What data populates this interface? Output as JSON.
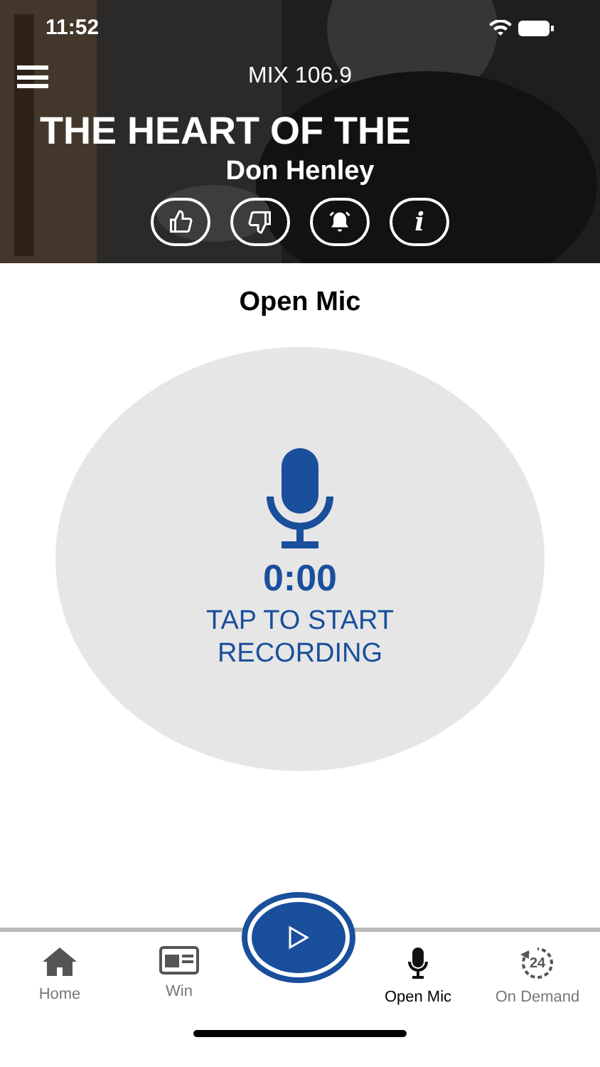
{
  "status_bar": {
    "time": "11:52"
  },
  "header": {
    "station": "MIX 106.9",
    "song_title": "THE HEART OF THE",
    "artist": "Don Henley",
    "actions": [
      {
        "kind": "like"
      },
      {
        "kind": "dislike"
      },
      {
        "kind": "alarm"
      },
      {
        "kind": "info",
        "label": "i"
      }
    ]
  },
  "page_title": "Open Mic",
  "recorder": {
    "timer": "0:00",
    "prompt": "TAP TO START RECORDING"
  },
  "tabs": [
    {
      "kind": "home",
      "label": "Home",
      "selected": false
    },
    {
      "kind": "win",
      "label": "Win",
      "selected": false
    },
    {
      "kind": "play"
    },
    {
      "kind": "mic",
      "label": "Open Mic",
      "selected": true
    },
    {
      "kind": "demand",
      "label": "On Demand",
      "badge": "24",
      "selected": false
    }
  ]
}
